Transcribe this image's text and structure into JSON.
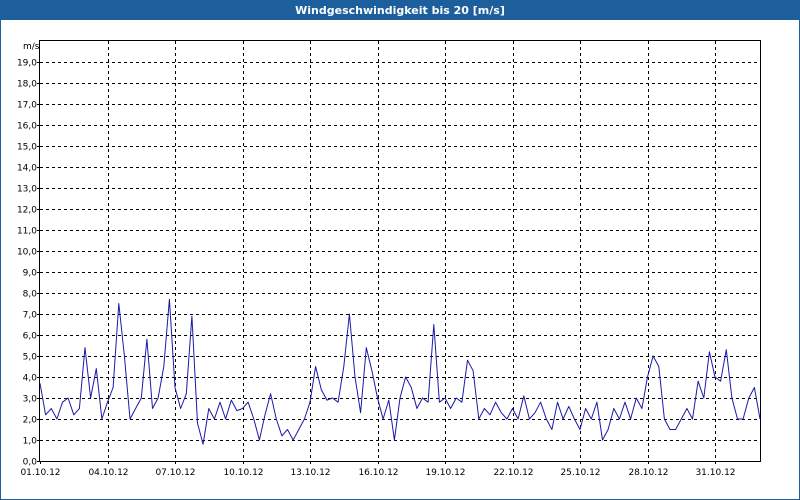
{
  "window": {
    "title": "Windgeschwindigkeit bis 20 [m/s]",
    "title_bar_color": "#1c5f9c"
  },
  "chart_data": {
    "type": "line",
    "title": "Windgeschwindigkeit bis 20 [m/s]",
    "ylabel": "m/s",
    "xlabel": "",
    "ylim": [
      0,
      20
    ],
    "xlim": [
      "2012-10-01",
      "2012-11-02"
    ],
    "y_ticks": [
      "0,0",
      "1,0",
      "2,0",
      "3,0",
      "4,0",
      "5,0",
      "6,0",
      "7,0",
      "8,0",
      "9,0",
      "10,0",
      "11,0",
      "12,0",
      "13,0",
      "14,0",
      "15,0",
      "16,0",
      "17,0",
      "18,0",
      "19,0"
    ],
    "x_ticks": [
      "01.10.12",
      "04.10.12",
      "07.10.12",
      "10.10.12",
      "13.10.12",
      "16.10.12",
      "19.10.12",
      "22.10.12",
      "25.10.12",
      "28.10.12",
      "31.10.12"
    ],
    "grid": true,
    "grid_style": "dashed",
    "series": [
      {
        "color": "#1a1aaa",
        "x": [
          "2012-10-01 00:00",
          "2012-10-01 06:00",
          "2012-10-01 12:00",
          "2012-10-01 18:00",
          "2012-10-02 00:00",
          "2012-10-02 06:00",
          "2012-10-02 12:00",
          "2012-10-02 18:00",
          "2012-10-03 00:00",
          "2012-10-03 06:00",
          "2012-10-03 12:00",
          "2012-10-03 18:00",
          "2012-10-04 00:00",
          "2012-10-04 06:00",
          "2012-10-04 12:00",
          "2012-10-04 18:00",
          "2012-10-05 00:00",
          "2012-10-05 06:00",
          "2012-10-05 12:00",
          "2012-10-05 18:00",
          "2012-10-06 00:00",
          "2012-10-06 06:00",
          "2012-10-06 12:00",
          "2012-10-06 18:00",
          "2012-10-07 00:00",
          "2012-10-07 06:00",
          "2012-10-07 12:00",
          "2012-10-07 18:00",
          "2012-10-08 00:00",
          "2012-10-08 06:00",
          "2012-10-08 12:00",
          "2012-10-08 18:00",
          "2012-10-09 00:00",
          "2012-10-09 06:00",
          "2012-10-09 12:00",
          "2012-10-09 18:00",
          "2012-10-10 00:00",
          "2012-10-10 06:00",
          "2012-10-10 12:00",
          "2012-10-10 18:00",
          "2012-10-11 00:00",
          "2012-10-11 06:00",
          "2012-10-11 12:00",
          "2012-10-11 18:00",
          "2012-10-12 00:00",
          "2012-10-12 06:00",
          "2012-10-12 12:00",
          "2012-10-12 18:00",
          "2012-10-13 00:00",
          "2012-10-13 06:00",
          "2012-10-13 12:00",
          "2012-10-13 18:00",
          "2012-10-14 00:00",
          "2012-10-14 06:00",
          "2012-10-14 12:00",
          "2012-10-14 18:00",
          "2012-10-15 00:00",
          "2012-10-15 06:00",
          "2012-10-15 12:00",
          "2012-10-15 18:00",
          "2012-10-16 00:00",
          "2012-10-16 06:00",
          "2012-10-16 12:00",
          "2012-10-16 18:00",
          "2012-10-17 00:00",
          "2012-10-17 06:00",
          "2012-10-17 12:00",
          "2012-10-17 18:00",
          "2012-10-18 00:00",
          "2012-10-18 06:00",
          "2012-10-18 12:00",
          "2012-10-18 18:00",
          "2012-10-19 00:00",
          "2012-10-19 06:00",
          "2012-10-19 12:00",
          "2012-10-19 18:00",
          "2012-10-20 00:00",
          "2012-10-20 06:00",
          "2012-10-20 12:00",
          "2012-10-20 18:00",
          "2012-10-21 00:00",
          "2012-10-21 06:00",
          "2012-10-21 12:00",
          "2012-10-21 18:00",
          "2012-10-22 00:00",
          "2012-10-22 06:00",
          "2012-10-22 12:00",
          "2012-10-22 18:00",
          "2012-10-23 00:00",
          "2012-10-23 06:00",
          "2012-10-23 12:00",
          "2012-10-23 18:00",
          "2012-10-24 00:00",
          "2012-10-24 06:00",
          "2012-10-24 12:00",
          "2012-10-24 18:00",
          "2012-10-25 00:00",
          "2012-10-25 06:00",
          "2012-10-25 12:00",
          "2012-10-25 18:00",
          "2012-10-26 00:00",
          "2012-10-26 06:00",
          "2012-10-26 12:00",
          "2012-10-26 18:00",
          "2012-10-27 00:00",
          "2012-10-27 06:00",
          "2012-10-27 12:00",
          "2012-10-27 18:00",
          "2012-10-28 00:00",
          "2012-10-28 06:00",
          "2012-10-28 12:00",
          "2012-10-28 18:00",
          "2012-10-29 00:00",
          "2012-10-29 06:00",
          "2012-10-29 12:00",
          "2012-10-29 18:00",
          "2012-10-30 00:00",
          "2012-10-30 06:00",
          "2012-10-30 12:00",
          "2012-10-30 18:00",
          "2012-10-31 00:00",
          "2012-10-31 06:00",
          "2012-10-31 12:00",
          "2012-10-31 18:00",
          "2012-11-01 00:00",
          "2012-11-01 06:00",
          "2012-11-01 12:00",
          "2012-11-01 18:00",
          "2012-11-02 00:00"
        ],
        "y": [
          3.7,
          2.2,
          2.5,
          2.0,
          2.8,
          3.0,
          2.2,
          2.5,
          5.4,
          3.0,
          4.4,
          2.0,
          2.8,
          3.5,
          7.5,
          5.0,
          2.0,
          2.5,
          3.0,
          5.8,
          2.5,
          3.0,
          4.5,
          7.7,
          3.5,
          2.5,
          3.2,
          6.9,
          1.8,
          0.8,
          2.5,
          2.0,
          2.8,
          2.0,
          2.9,
          2.4,
          2.5,
          2.8,
          2.0,
          1.0,
          2.2,
          3.2,
          2.0,
          1.2,
          1.5,
          1.0,
          1.5,
          2.0,
          2.8,
          4.5,
          3.4,
          2.9,
          3.0,
          2.8,
          4.5,
          7.0,
          4.0,
          2.3,
          5.4,
          4.3,
          3.0,
          2.0,
          2.9,
          1.0,
          3.0,
          4.0,
          3.5,
          2.5,
          3.0,
          2.8,
          6.5,
          2.8,
          3.0,
          2.5,
          3.0,
          2.8,
          4.8,
          4.3,
          2.0,
          2.5,
          2.2,
          2.8,
          2.3,
          2.0,
          2.5,
          2.0,
          3.1,
          2.0,
          2.3,
          2.8,
          2.0,
          1.5,
          2.8,
          2.0,
          2.6,
          2.0,
          1.5,
          2.5,
          2.0,
          2.8,
          1.0,
          1.5,
          2.5,
          2.0,
          2.8,
          2.0,
          3.0,
          2.5,
          4.0,
          5.0,
          4.5,
          2.0,
          1.5,
          1.5,
          2.0,
          2.5,
          2.0,
          3.8,
          3.0,
          5.2,
          4.0,
          3.8,
          5.3,
          3.0,
          2.0,
          2.0,
          3.0,
          3.5,
          2.0
        ]
      }
    ]
  }
}
